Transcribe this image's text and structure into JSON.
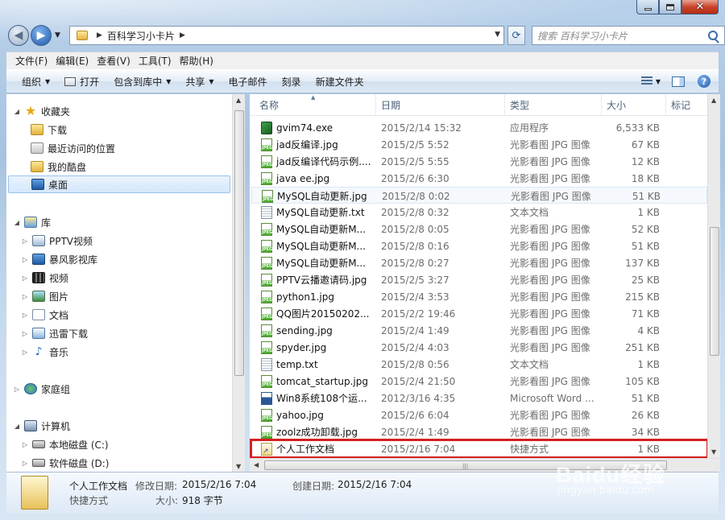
{
  "window": {
    "close_glyph": "✕"
  },
  "address": {
    "path_segment": "百科学习小卡片",
    "search_placeholder": "搜索 百科学习小卡片"
  },
  "menu": [
    "文件(F)",
    "编辑(E)",
    "查看(V)",
    "工具(T)",
    "帮助(H)"
  ],
  "commands": {
    "organize": "组织",
    "open": "打开",
    "include_library": "包含到库中",
    "share": "共享",
    "email": "电子邮件",
    "burn": "刻录",
    "new_folder": "新建文件夹"
  },
  "nav": {
    "favorites": "收藏夹",
    "downloads": "下载",
    "recent": "最近访问的位置",
    "kupan": "我的酷盘",
    "desktop": "桌面",
    "libraries": "库",
    "pptv": "PPTV视频",
    "baofeng": "暴风影视库",
    "videos": "视频",
    "pictures": "图片",
    "documents": "文档",
    "xunlei": "迅雷下载",
    "music": "音乐",
    "homegroup": "家庭组",
    "computer": "计算机",
    "drive_c": "本地磁盘 (C:)",
    "drive_d": "软件磁盘 (D:)"
  },
  "columns": {
    "name": "名称",
    "date": "日期",
    "type": "类型",
    "size": "大小",
    "tags": "标记"
  },
  "files": [
    {
      "icon": "exe",
      "name": "gvim74.exe",
      "date": "2015/2/14 15:32",
      "type": "应用程序",
      "size": "6,533 KB"
    },
    {
      "icon": "jpeg",
      "name": "jad反编译.jpg",
      "date": "2015/2/5 5:52",
      "type": "光影看图 JPG 图像",
      "size": "67 KB"
    },
    {
      "icon": "jpeg",
      "name": "jad反编译代码示例....",
      "date": "2015/2/5 5:55",
      "type": "光影看图 JPG 图像",
      "size": "12 KB"
    },
    {
      "icon": "jpeg",
      "name": "java ee.jpg",
      "date": "2015/2/6 6:30",
      "type": "光影看图 JPG 图像",
      "size": "18 KB"
    },
    {
      "icon": "jpeg",
      "name": "MySQL自动更新.jpg",
      "date": "2015/2/8 0:02",
      "type": "光影看图 JPG 图像",
      "size": "51 KB"
    },
    {
      "icon": "txt",
      "name": "MySQL自动更新.txt",
      "date": "2015/2/8 0:32",
      "type": "文本文档",
      "size": "1 KB"
    },
    {
      "icon": "jpeg",
      "name": "MySQL自动更新M...",
      "date": "2015/2/8 0:05",
      "type": "光影看图 JPG 图像",
      "size": "52 KB"
    },
    {
      "icon": "jpeg",
      "name": "MySQL自动更新M...",
      "date": "2015/2/8 0:16",
      "type": "光影看图 JPG 图像",
      "size": "51 KB"
    },
    {
      "icon": "jpeg",
      "name": "MySQL自动更新M...",
      "date": "2015/2/8 0:27",
      "type": "光影看图 JPG 图像",
      "size": "137 KB"
    },
    {
      "icon": "jpeg",
      "name": "PPTV云播邀请码.jpg",
      "date": "2015/2/5 3:27",
      "type": "光影看图 JPG 图像",
      "size": "25 KB"
    },
    {
      "icon": "jpeg",
      "name": "python1.jpg",
      "date": "2015/2/4 3:53",
      "type": "光影看图 JPG 图像",
      "size": "215 KB"
    },
    {
      "icon": "jpeg",
      "name": "QQ图片20150202...",
      "date": "2015/2/2 19:46",
      "type": "光影看图 JPG 图像",
      "size": "71 KB"
    },
    {
      "icon": "jpeg",
      "name": "sending.jpg",
      "date": "2015/2/4 1:49",
      "type": "光影看图 JPG 图像",
      "size": "4 KB"
    },
    {
      "icon": "jpeg",
      "name": "spyder.jpg",
      "date": "2015/2/4 4:03",
      "type": "光影看图 JPG 图像",
      "size": "251 KB"
    },
    {
      "icon": "txt",
      "name": "temp.txt",
      "date": "2015/2/8 0:56",
      "type": "文本文档",
      "size": "1 KB"
    },
    {
      "icon": "jpeg",
      "name": "tomcat_startup.jpg",
      "date": "2015/2/4 21:50",
      "type": "光影看图 JPG 图像",
      "size": "105 KB"
    },
    {
      "icon": "doc",
      "name": "Win8系统108个运...",
      "date": "2012/3/16 4:35",
      "type": "Microsoft Word ...",
      "size": "51 KB"
    },
    {
      "icon": "jpeg",
      "name": "yahoo.jpg",
      "date": "2015/2/6 6:04",
      "type": "光影看图 JPG 图像",
      "size": "26 KB"
    },
    {
      "icon": "jpeg",
      "name": "zoolz成功卸载.jpg",
      "date": "2015/2/4 1:49",
      "type": "光影看图 JPG 图像",
      "size": "34 KB"
    },
    {
      "icon": "lnk",
      "name": "个人工作文档",
      "date": "2015/2/16 7:04",
      "type": "快捷方式",
      "size": "1 KB"
    }
  ],
  "details": {
    "name": "个人工作文档",
    "modified_label": "修改日期:",
    "modified_value": "2015/2/16 7:04",
    "created_label": "创建日期:",
    "created_value": "2015/2/16 7:04",
    "type": "快捷方式",
    "size_label": "大小:",
    "size_value": "918 字节"
  },
  "watermark": {
    "logo": "Baidu经验",
    "url": "jingyan.baidu.com"
  }
}
